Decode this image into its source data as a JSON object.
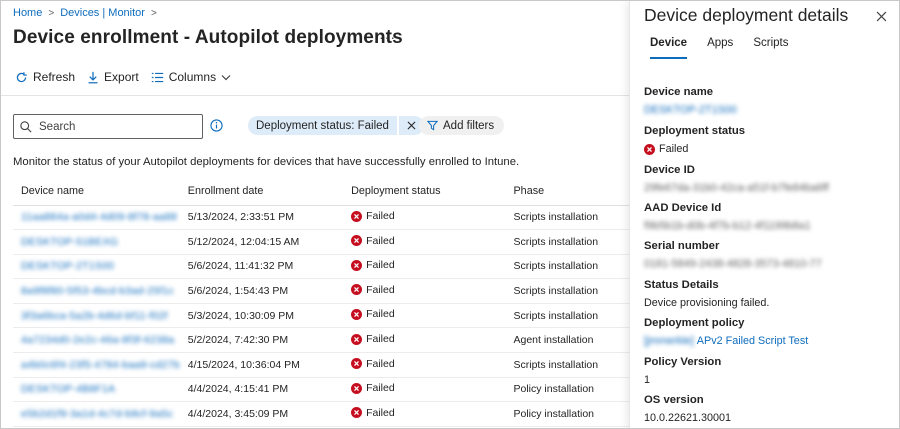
{
  "breadcrumb": {
    "home": "Home",
    "devices": "Devices | Monitor"
  },
  "page_title": "Device enrollment - Autopilot deployments",
  "title_more": "···",
  "toolbar": {
    "refresh": "Refresh",
    "export": "Export",
    "columns": "Columns"
  },
  "search": {
    "placeholder": "Search",
    "value": ""
  },
  "filter": {
    "pill_label": "Deployment status: Failed",
    "add_filters": "Add filters"
  },
  "description": "Monitor the status of your Autopilot deployments for devices that have successfully enrolled to Intune.",
  "table": {
    "headers": [
      "Device name",
      "Enrollment date",
      "Deployment status",
      "Phase"
    ],
    "rows": [
      {
        "name": "11aa884a-a0d4-4d09-8f78-aa88",
        "date": "5/13/2024, 2:33:51 PM",
        "status": "Failed",
        "phase": "Scripts installation"
      },
      {
        "name": "DESKTOP-51BEXG",
        "date": "5/12/2024, 12:04:15 AM",
        "status": "Failed",
        "phase": "Scripts installation"
      },
      {
        "name": "DESKTOP-2T1S00",
        "date": "5/6/2024, 11:41:32 PM",
        "status": "Failed",
        "phase": "Scripts installation"
      },
      {
        "name": "8a9f8f80-5f53-4bcd-b3ad-25f1c",
        "date": "5/6/2024, 1:54:43 PM",
        "status": "Failed",
        "phase": "Scripts installation"
      },
      {
        "name": "3f3a6bca-5a2b-4d6d-bf11-f02f",
        "date": "5/3/2024, 10:30:09 PM",
        "status": "Failed",
        "phase": "Scripts installation"
      },
      {
        "name": "4a7234d0-2e2c-46a-8f3f-6238a",
        "date": "5/2/2024, 7:42:30 PM",
        "status": "Failed",
        "phase": "Agent installation"
      },
      {
        "name": "a4b0c6f4-23f5-4784-baa9-cd27b",
        "date": "4/15/2024, 10:36:04 PM",
        "status": "Failed",
        "phase": "Scripts installation"
      },
      {
        "name": "DESKTOP-4B8F1A",
        "date": "4/4/2024, 4:15:41 PM",
        "status": "Failed",
        "phase": "Policy installation"
      },
      {
        "name": "e5b2d1f9-3a1d-4c7d-b9cf-9a5c",
        "date": "4/4/2024, 3:45:09 PM",
        "status": "Failed",
        "phase": "Policy installation"
      }
    ]
  },
  "panel": {
    "title": "Device deployment details",
    "tabs": [
      "Device",
      "Apps",
      "Scripts"
    ],
    "fields": {
      "device_name_label": "Device name",
      "device_name_value": "DESKTOP-2T1S00",
      "deployment_status_label": "Deployment status",
      "deployment_status_value": "Failed",
      "device_id_label": "Device ID",
      "device_id_value": "29fe67da-31b0-42ca-a51f-b7fe84ba6ff",
      "aad_device_id_label": "AAD Device Id",
      "aad_device_id_value": "f9b5b1b-d0b-4f7b-b12-4f1199b8a1",
      "serial_number_label": "Serial number",
      "serial_number_value": "0181-5849-2438-4828-3573-4810-77",
      "status_details_label": "Status Details",
      "status_details_value": "Device provisioning failed.",
      "deployment_policy_label": "Deployment policy",
      "deployment_policy_prefix": "[jmmerkle]",
      "deployment_policy_value": "APv2 Failed Script Test",
      "policy_version_label": "Policy Version",
      "policy_version_value": "1",
      "os_version_label": "OS version",
      "os_version_value": "10.0.22621.30001"
    }
  },
  "colors": {
    "accent": "#0f6cbd",
    "error": "#c50f1f",
    "pill": "#deecf9"
  }
}
